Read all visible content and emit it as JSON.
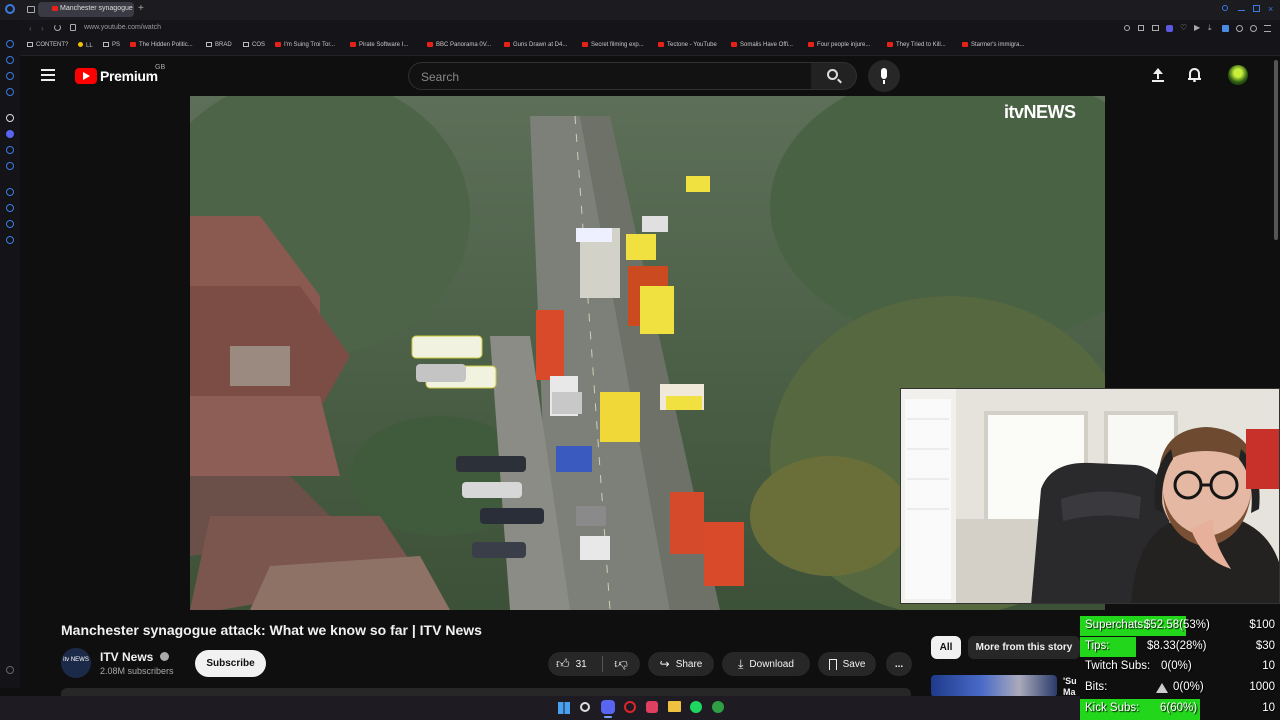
{
  "browser": {
    "tab_title": "Manchester synagogue",
    "url": "www.youtube.com/watch",
    "bookmarks": [
      "CONTENT?",
      "LL",
      "PS",
      "The Hidden Politic...",
      "BRAD",
      "COS",
      "I'm Suing Troi Tor...",
      "Pirate Software I...",
      "BBC Panorama 0V...",
      "Guns Drawn at D4...",
      "Secret filming exp...",
      "Tectone - YouTube",
      "Somalis Have Offi...",
      "Four people injure...",
      "They Tried to Kill...",
      "Starmer's immigra..."
    ]
  },
  "youtube": {
    "logo_text": "Premium",
    "region": "GB",
    "search_placeholder": "Search"
  },
  "video": {
    "watermark": "itvNEWS",
    "title": "Manchester synagogue attack: What we know so far | ITV News",
    "channel_name": "ITV News",
    "channel_avatar_text": "itv NEWS",
    "subscribers": "2.08M subscribers",
    "subscribe_label": "Subscribe",
    "like_count": "31",
    "share_label": "Share",
    "download_label": "Download",
    "save_label": "Save",
    "more_label": "...",
    "chips": [
      "All",
      "More from this story"
    ],
    "rec_title_fragment": "'Su",
    "rec_title_fragment2": "Ma"
  },
  "stats_overlay": {
    "rows": [
      {
        "label": "Superchats:",
        "value": "$52.58(53%)",
        "goal": "$100",
        "progress": 0.53
      },
      {
        "label": "Tips:",
        "value": "$8.33(28%)",
        "goal": "$30",
        "progress": 0.28
      },
      {
        "label": "Twitch Subs:",
        "value": "0(0%)",
        "goal": "10",
        "progress": 0
      },
      {
        "label": "Bits:",
        "value": "0(0%)",
        "goal": "1000",
        "progress": 0
      },
      {
        "label": "Kick Subs:",
        "value": "6(60%)",
        "goal": "10",
        "progress": 0.6
      }
    ]
  },
  "colors": {
    "youtube_red": "#ff0000",
    "progress_green": "#22d61b",
    "background": "#0f0f0f"
  }
}
